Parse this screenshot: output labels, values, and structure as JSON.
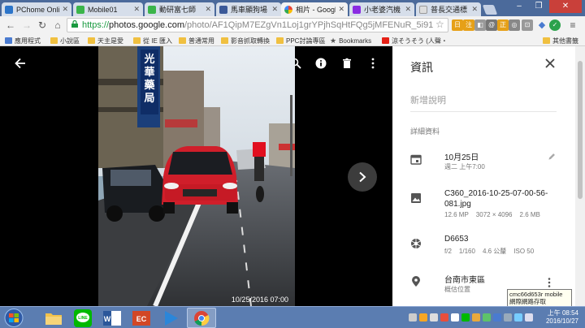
{
  "tabs": [
    {
      "title": "PChome Online",
      "color": "#2b74c9",
      "active": false
    },
    {
      "title": "Mobile01",
      "color": "#3bb54a",
      "active": false
    },
    {
      "title": "動研富七師",
      "color": "#3bb54a",
      "active": false
    },
    {
      "title": "馬車顯狗場",
      "color": "#3b5998",
      "active": false
    },
    {
      "title": "相片 - Google",
      "color": "#fbbc05",
      "active": true
    },
    {
      "title": "小老婆汽機",
      "color": "#8a2be2",
      "active": false
    },
    {
      "title": "普長交通標",
      "color": "#dddddd",
      "active": false
    }
  ],
  "address_bar": {
    "scheme": "https://",
    "host": "photos.google.com",
    "path": "/photo/AF1QipM7EZgVn1Loj1grYPjhSqHtFQg5jMFENuR_5i91"
  },
  "bookmarks": [
    {
      "label": "應用程式",
      "color": "#4a7bd0"
    },
    {
      "label": "小說區",
      "color": "#f0c040"
    },
    {
      "label": "天主是愛",
      "color": "#f0c040"
    },
    {
      "label": "從 IE 匯入",
      "color": "#f0c040"
    },
    {
      "label": "普通常用",
      "color": "#f0c040"
    },
    {
      "label": "影音抓取轉換",
      "color": "#f0c040"
    },
    {
      "label": "PPC討論專區",
      "color": "#f0c040"
    },
    {
      "label": "Bookmarks",
      "color": "#555555"
    },
    {
      "label": "涼そうそう (人聲・",
      "color": "#e62117"
    },
    {
      "label": "其他書籤",
      "color": "#f0c040"
    }
  ],
  "viewer": {
    "photo_date": "10/25/2016 07:00",
    "sign_text": "光華藥局"
  },
  "info_panel": {
    "title": "資訊",
    "description_placeholder": "新增說明",
    "details_header": "詳細資料",
    "date": {
      "main": "10月25日",
      "sub": "週二 上午7:00"
    },
    "file": {
      "name_line1": "C360_2016-10-25-07-00-56-",
      "name_line2": "081.jpg",
      "megapixels": "12.6 MP",
      "resolution": "3072 × 4096",
      "size": "2.6 MB"
    },
    "camera": {
      "model": "D6653",
      "aperture": "f/2",
      "shutter": "1/160",
      "focal": "4.6 公釐",
      "iso": "ISO 50"
    },
    "location": {
      "name": "台南市東區",
      "sub": "概估位置"
    }
  },
  "tooltip": {
    "line1": "cmc66d653r mobile",
    "line2": "網際網路存取"
  },
  "taskbar": {
    "time": "上午 08:54",
    "date": "2016/10/27"
  }
}
